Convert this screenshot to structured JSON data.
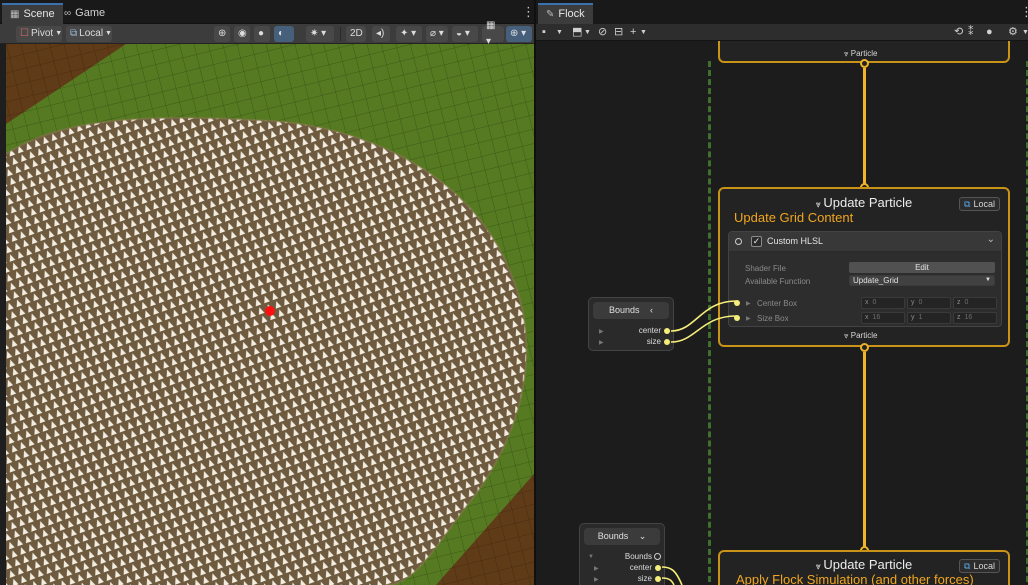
{
  "scene": {
    "tabs": [
      {
        "label": "Scene",
        "icon": "grid-icon",
        "active": true
      },
      {
        "label": "Game",
        "icon": "gamepad-icon",
        "active": false
      }
    ],
    "toolbar": {
      "pivot_label": "Pivot",
      "local_label": "Local",
      "mode_2d_label": "2D"
    }
  },
  "graph": {
    "tab_label": "Flock",
    "tab_icon": "vfx-graph-icon",
    "contexts": [
      {
        "title": "Update Particle",
        "subtitle": "Update Grid Content",
        "space_label": "Local",
        "block": {
          "title": "Custom HLSL",
          "enabled": true,
          "shader_file_label": "Shader File",
          "edit_label": "Edit",
          "available_function_label": "Available Function",
          "function_value": "Update_Grid",
          "inputs": [
            {
              "label": "Center Box",
              "x": "0",
              "y": "0",
              "z": "0"
            },
            {
              "label": "Size Box",
              "x": "16",
              "y": "1",
              "z": "16"
            }
          ]
        },
        "output_label": "Particle"
      },
      {
        "title": "Update Particle",
        "subtitle": "Apply Flock Simulation (and other forces)",
        "space_label": "Local"
      }
    ],
    "top_context_output_label": "Particle",
    "operators": [
      {
        "title": "Bounds",
        "ports": [
          "center",
          "size"
        ]
      },
      {
        "title": "Bounds",
        "ports": [
          "Bounds",
          "center",
          "size"
        ]
      }
    ],
    "colors": {
      "flow": "#f2b52a",
      "context_border": "#c89316",
      "subtitle": "#f0a61f",
      "port_vector": "#f5ee7a",
      "dashed_line": "#3f6f2c"
    }
  }
}
